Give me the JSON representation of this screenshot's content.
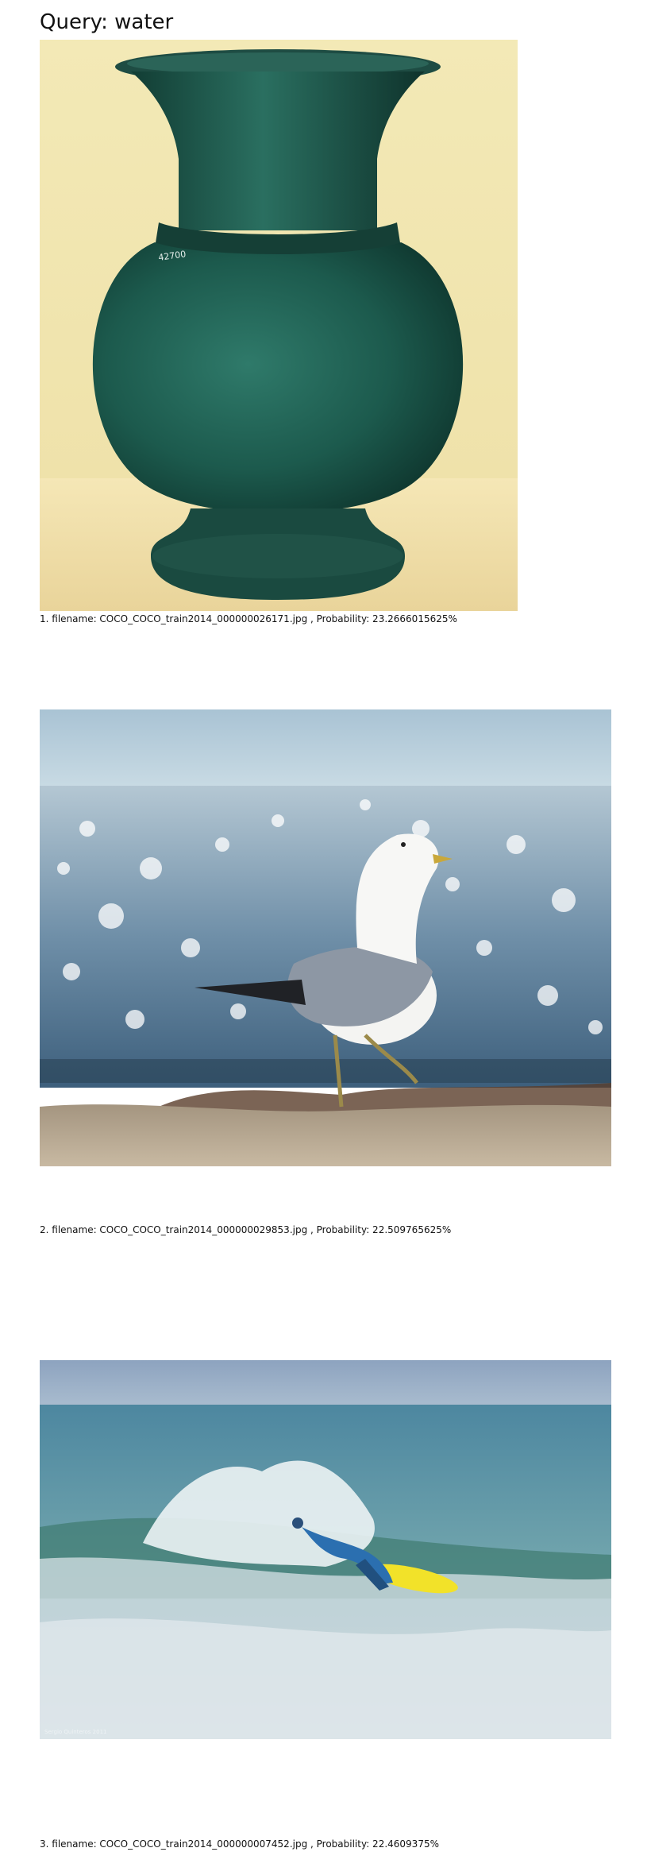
{
  "page": {
    "query_label": "Query: water"
  },
  "results": [
    {
      "caption": "1. filename: COCO_COCO_train2014_000000026171.jpg , Probability: 23.2666015625%",
      "image_subject": "green-vase"
    },
    {
      "caption": "2. filename: COCO_COCO_train2014_000000029853.jpg , Probability: 22.509765625%",
      "image_subject": "seagull-on-beach"
    },
    {
      "caption": "3. filename: COCO_COCO_train2014_000000007452.jpg , Probability: 22.4609375%",
      "image_subject": "surfer-on-wave"
    }
  ]
}
